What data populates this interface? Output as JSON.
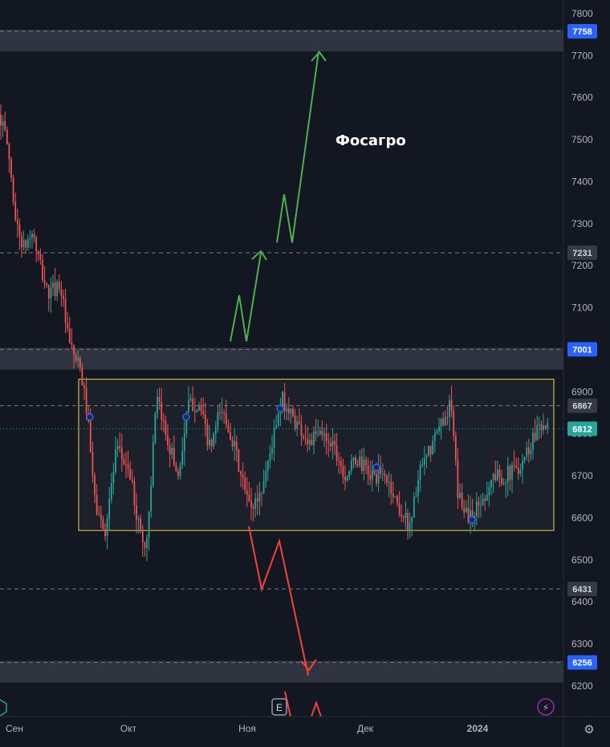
{
  "chart_data": {
    "type": "candlestick",
    "title": "Фосагро",
    "y_ticks": [
      7800,
      7700,
      7600,
      7500,
      7400,
      7300,
      7200,
      7100,
      6900,
      6800,
      6700,
      6600,
      6500,
      6400,
      6300,
      6200
    ],
    "x_labels": [
      "Сен",
      "Окт",
      "Ноя",
      "Дек",
      "2024"
    ],
    "ylim": [
      6150,
      7830
    ],
    "levels": [
      {
        "value": 7758,
        "label": "7758",
        "style": "zone"
      },
      {
        "value": 7231,
        "label": "7231",
        "style": "dashed"
      },
      {
        "value": 7001,
        "label": "7001",
        "style": "zone"
      },
      {
        "value": 6867,
        "label": "6867",
        "style": "dashed"
      },
      {
        "value": 6812,
        "label": "6812",
        "style": "last-price"
      },
      {
        "value": 6431,
        "label": "6431",
        "style": "dashed"
      },
      {
        "value": 6256,
        "label": "6256",
        "style": "zone"
      }
    ],
    "range_box": {
      "low": 6570,
      "high": 6930
    },
    "bullish_scenario": [
      7020,
      7130,
      7020,
      7230,
      7255,
      7370,
      7255,
      7710
    ],
    "bearish_scenario": [
      6580,
      6430,
      6545,
      6225
    ],
    "colors": {
      "up": "#26a69a",
      "down": "#ef5350",
      "bullish_arrow": "#4caf50",
      "bearish_arrow": "#f44336",
      "box": "#e8d44d",
      "zone": "#363a45",
      "background": "#131722"
    }
  },
  "toolbar": {
    "earnings_icon": "E",
    "lightning_icon": "⚡",
    "settings_icon": "⚙"
  }
}
